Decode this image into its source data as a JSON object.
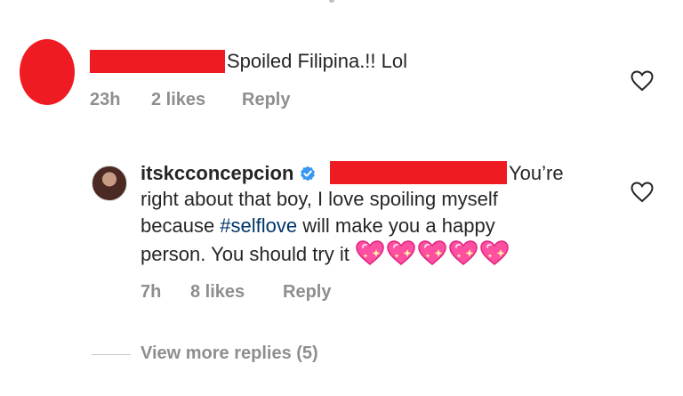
{
  "comment1": {
    "text": "Spoiled Filipina.!! Lol",
    "time": "23h",
    "likes": "2 likes",
    "reply": "Reply"
  },
  "reply1": {
    "username": "itskcconcepcion",
    "text_after_redaction": "You’re",
    "line2": "right about that boy, I love spoiling myself",
    "line3_prefix": "because ",
    "hashtag": "#selflove",
    "line3_suffix": " will make you a happy",
    "line4": "person. You should try it",
    "time": "7h",
    "likes": "8 likes",
    "reply": "Reply"
  },
  "view_more": "View more replies (5)",
  "colors": {
    "redaction": "#ee1b22",
    "meta_gray": "#8e8e8e",
    "hashtag_blue": "#003569",
    "verified_blue": "#3897f0",
    "heart_pink": "#ff4fa0"
  },
  "icons": [
    "heart-outline-icon",
    "verified-badge-icon",
    "sparkling-heart-emoji"
  ]
}
